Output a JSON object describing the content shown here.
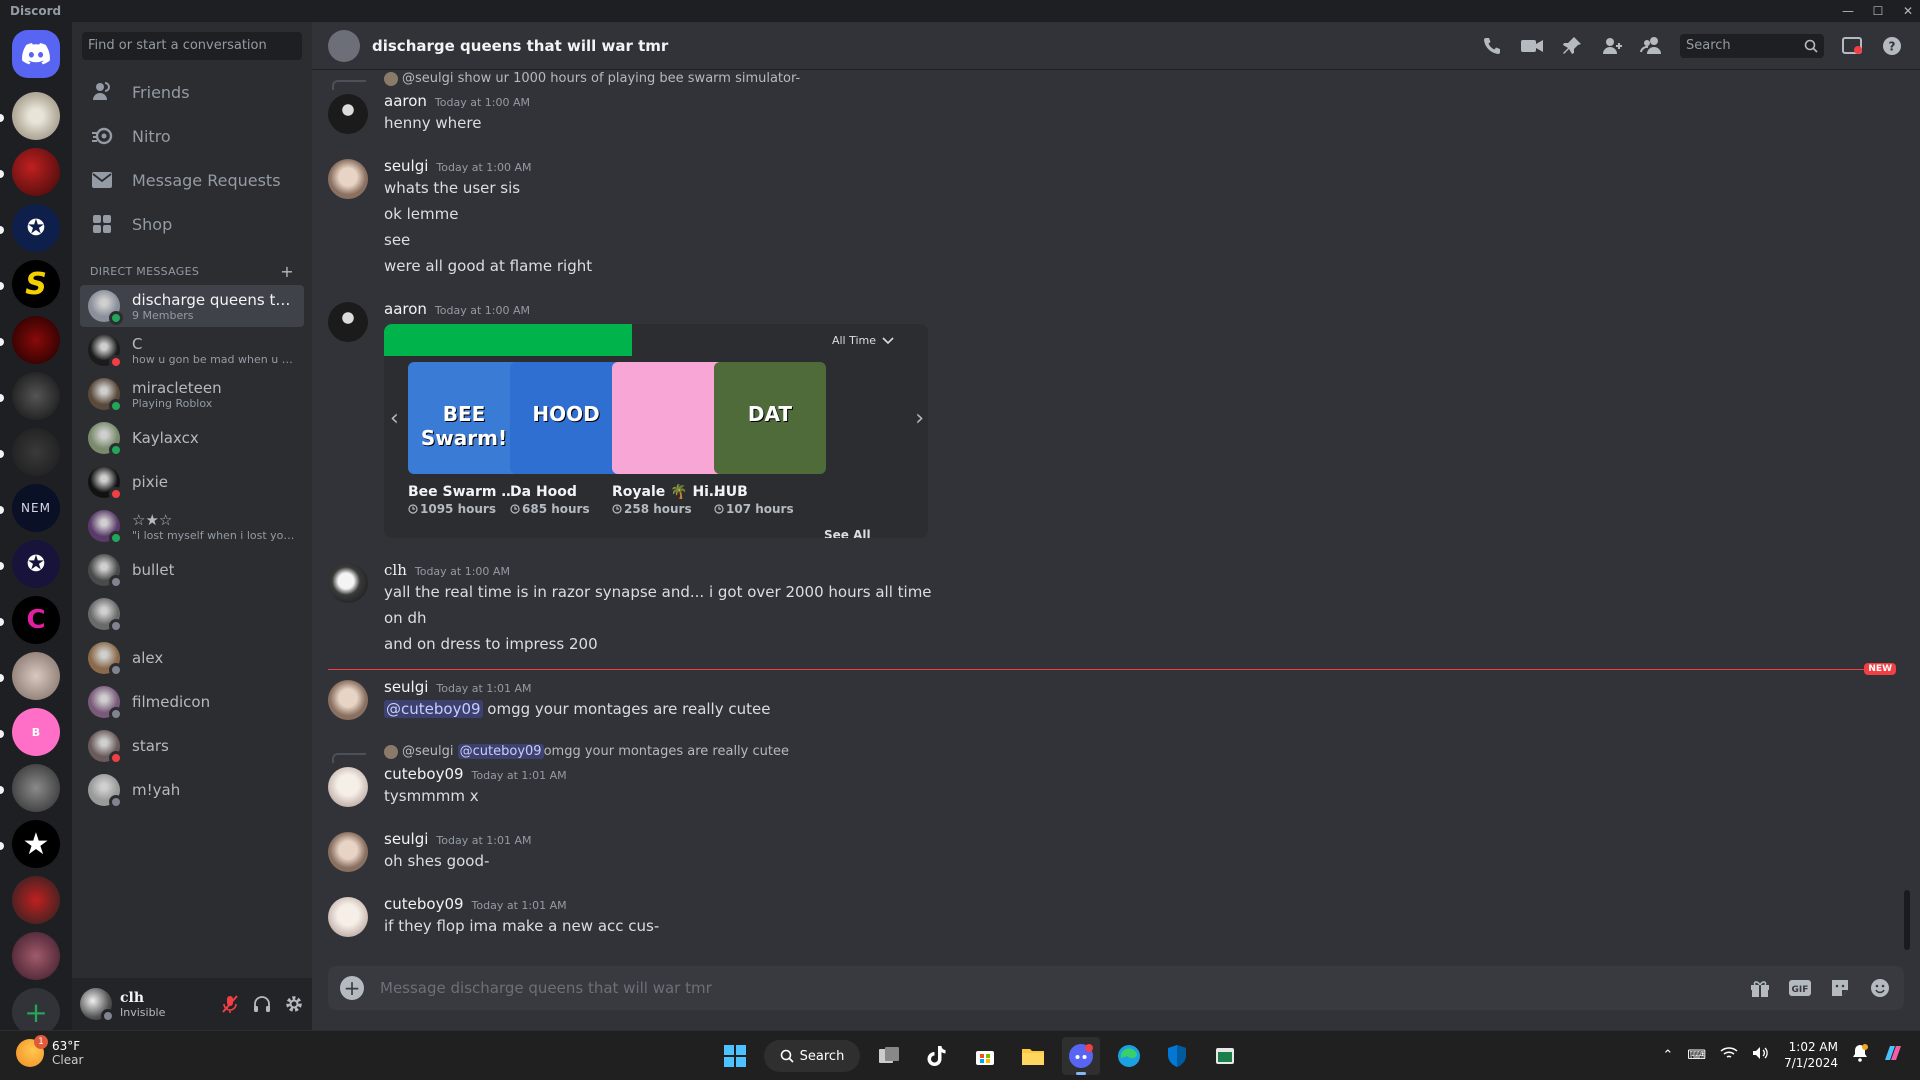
{
  "window": {
    "app_name": "Discord"
  },
  "sidebar": {
    "search_placeholder": "Find or start a conversation",
    "nav": [
      {
        "label": "Friends",
        "icon": "friends-icon"
      },
      {
        "label": "Nitro",
        "icon": "nitro-icon"
      },
      {
        "label": "Message Requests",
        "icon": "envelope-icon"
      },
      {
        "label": "Shop",
        "icon": "shop-icon"
      }
    ],
    "dm_header": "DIRECT MESSAGES",
    "dms": [
      {
        "name": "discharge queens tha...",
        "sub": "9 Members",
        "status": "online",
        "color": "#8a8f9a"
      },
      {
        "name": "C",
        "sub": "how u gon be mad when u did...",
        "status": "dnd",
        "color": "#1b1b1b"
      },
      {
        "name": "miracleteen",
        "sub": "Playing Roblox",
        "status": "online",
        "color": "#5a4a3a"
      },
      {
        "name": "Kaylaxcx",
        "sub": "",
        "status": "online",
        "color": "#7a8a6a"
      },
      {
        "name": "pixie",
        "sub": "",
        "status": "dnd",
        "color": "#121212"
      },
      {
        "name": "☆★☆",
        "sub": "\"i lost myself when i lost you ...",
        "status": "online",
        "color": "#5a3a6a"
      },
      {
        "name": "bullet",
        "sub": "",
        "status": "offline",
        "color": "#4a4a4a"
      },
      {
        "name": "",
        "sub": "",
        "status": "offline",
        "color": "#6a6a6a"
      },
      {
        "name": "alex",
        "sub": "",
        "status": "offline",
        "color": "#8a6a4a"
      },
      {
        "name": "filmedicon",
        "sub": "",
        "status": "offline",
        "color": "#7a5a7a"
      },
      {
        "name": "stars",
        "sub": "",
        "status": "dnd",
        "color": "#6a5a5a"
      },
      {
        "name": "m!yah",
        "sub": "",
        "status": "offline",
        "color": "#9a9a9a"
      }
    ]
  },
  "user_panel": {
    "name": "clh",
    "status": "Invisible"
  },
  "header": {
    "title": "discharge queens that will war tmr",
    "search_placeholder": "Search"
  },
  "messages": {
    "reply1": {
      "author": "@seulgi",
      "text": "show ur 1000 hours of playing bee swarm simulator-"
    },
    "m1": {
      "author": "aaron",
      "time": "Today at 1:00 AM",
      "lines": [
        "henny where"
      ]
    },
    "m2": {
      "author": "seulgi",
      "time": "Today at 1:00 AM",
      "lines": [
        "whats the user sis",
        "ok lemme",
        "see",
        "were all good at flame right"
      ]
    },
    "m3": {
      "author": "aaron",
      "time": "Today at 1:00 AM"
    },
    "m4": {
      "author": "clh",
      "time": "Today at 1:00 AM",
      "lines": [
        "yall the real time is in razor synapse and... i got over 2000 hours all time",
        "on dh",
        "and on dress to impress 200"
      ]
    },
    "new_label": "NEW",
    "m5": {
      "author": "seulgi",
      "time": "Today at 1:01 AM",
      "mention": "@cuteboy09",
      "text": " omgg your montages are really cutee"
    },
    "reply2": {
      "author": "@seulgi",
      "mention": "@cuteboy09",
      "text": " omgg your montages are really cutee"
    },
    "m6": {
      "author": "cuteboy09",
      "time": "Today at 1:01 AM",
      "lines": [
        "tysmmmm x"
      ]
    },
    "m7": {
      "author": "seulgi",
      "time": "Today at 1:01 AM",
      "lines": [
        "oh shes good-"
      ]
    },
    "m8": {
      "author": "cuteboy09",
      "time": "Today at 1:01 AM",
      "lines": [
        "if they flop ima make a new acc cus-"
      ]
    }
  },
  "embed": {
    "filter": "All Time",
    "see_all": "See All",
    "accent": "#00b44b",
    "games": [
      {
        "name": "Bee Swarm Si...",
        "hours": "1095 hours",
        "thumb_text": "BEE Swarm!",
        "bg": "#3a7bd5"
      },
      {
        "name": "Da Hood",
        "hours": "685 hours",
        "thumb_text": "HOOD",
        "bg": "#2f6fd1"
      },
      {
        "name": "Royale 🌴 Hig...",
        "hours": "258 hours",
        "thumb_text": "",
        "bg": "#f7a6d6"
      },
      {
        "name": "HUB",
        "hours": "107 hours",
        "thumb_text": "DAT",
        "bg": "#4f6b3a"
      }
    ]
  },
  "composer": {
    "placeholder": "Message discharge queens that will war tmr"
  },
  "taskbar": {
    "weather_temp": "63°F",
    "weather_cond": "Clear",
    "weather_badge": "1",
    "search_label": "Search",
    "time": "1:02 AM",
    "date": "7/1/2024"
  }
}
